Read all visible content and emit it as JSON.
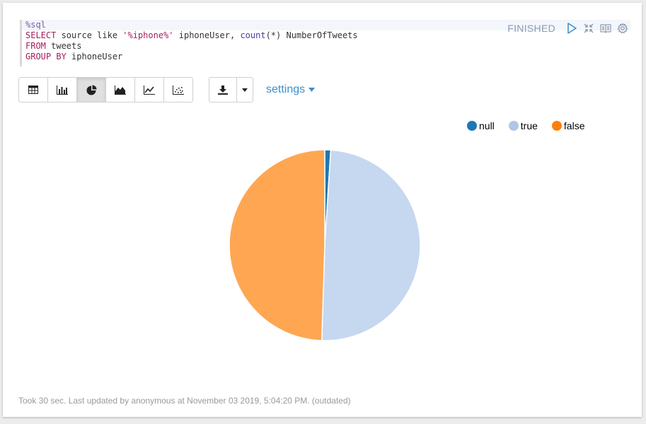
{
  "editor": {
    "lines": [
      [
        {
          "t": "%sql",
          "c": "magic"
        }
      ],
      [
        {
          "t": "SELECT",
          "c": "kw"
        },
        {
          "t": " source like ",
          "c": ""
        },
        {
          "t": "'%iphone%'",
          "c": "str"
        },
        {
          "t": " iphoneUser, ",
          "c": ""
        },
        {
          "t": "count",
          "c": "fn"
        },
        {
          "t": "(*) NumberOfTweets",
          "c": ""
        }
      ],
      [
        {
          "t": "FROM",
          "c": "kw"
        },
        {
          "t": " tweets",
          "c": ""
        }
      ],
      [
        {
          "t": "GROUP BY",
          "c": "kw"
        },
        {
          "t": " iphoneUser",
          "c": ""
        }
      ]
    ]
  },
  "status": {
    "text": "FINISHED"
  },
  "toolbar": {
    "buttons": [
      {
        "name": "table-view-button",
        "icon": "table-icon"
      },
      {
        "name": "bar-chart-button",
        "icon": "bar-chart-icon"
      },
      {
        "name": "pie-chart-button",
        "icon": "pie-chart-icon",
        "active": true
      },
      {
        "name": "area-chart-button",
        "icon": "area-chart-icon"
      },
      {
        "name": "line-chart-button",
        "icon": "line-chart-icon"
      },
      {
        "name": "scatter-chart-button",
        "icon": "scatter-chart-icon"
      }
    ],
    "settings_label": "settings"
  },
  "colors": {
    "accent": "#3c8dcd",
    "status": "#8d9cb0"
  },
  "chart_data": {
    "type": "pie",
    "categories": [
      "null",
      "true",
      "false"
    ],
    "values": [
      1,
      49.5,
      49.5
    ],
    "colors": [
      "#1f77b4",
      "#c6d7f0",
      "#ffa653"
    ],
    "legend_position": "top-right"
  },
  "legend_colors": [
    "#1f77b4",
    "#aec7e8",
    "#ff7f0e"
  ],
  "footer": {
    "text": "Took 30 sec. Last updated by anonymous at November 03 2019, 5:04:20 PM. (outdated)"
  }
}
